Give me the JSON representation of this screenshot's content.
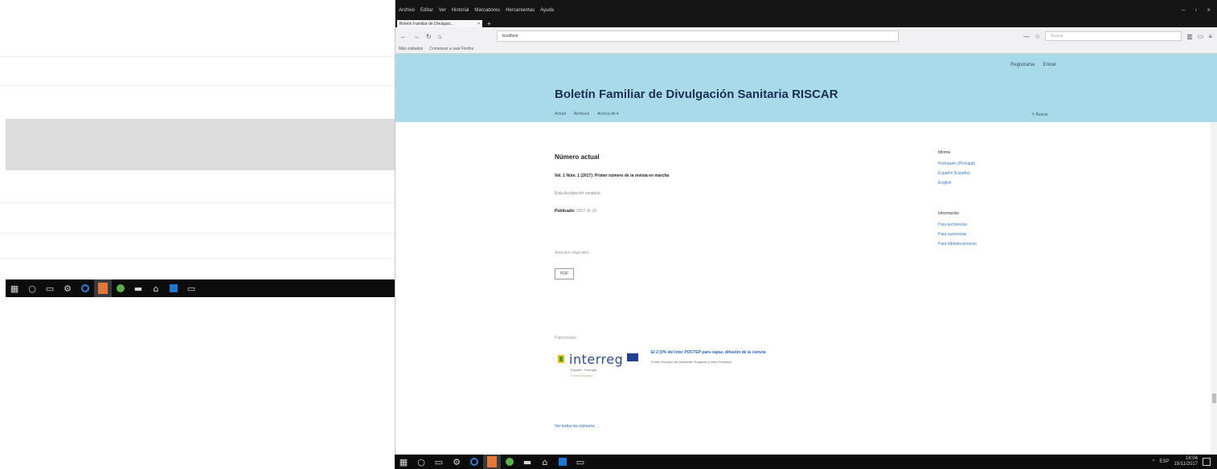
{
  "left_taskbar": {
    "icons": [
      "windows-start-icon",
      "search-icon",
      "task-view-icon",
      "settings-icon",
      "edge-icon",
      "firefox-icon",
      "chrome-icon",
      "folder-icon",
      "store-icon",
      "outlook-icon",
      "terminal-icon"
    ]
  },
  "browser": {
    "menu": [
      "Archivo",
      "Editar",
      "Ver",
      "Historial",
      "Marcadores",
      "Herramientas",
      "Ayuda"
    ],
    "tab_title": "Boletín Familiar de Divulgaci...",
    "url_host": "localhost",
    "bookmarks": [
      "Más visitados",
      "Comenzar a usar Firefox"
    ],
    "search_placeholder": "Buscar",
    "zoom": "—"
  },
  "site": {
    "user_links": [
      "Registrarse",
      "Entrar"
    ],
    "title": "Boletín Familiar de Divulgación Sanitaria RISCAR",
    "nav": [
      "Actual",
      "Archivos",
      "Acerca de ▾"
    ],
    "search_label": "Buscar"
  },
  "main": {
    "section_title": "Número actual",
    "issue_title": "Vol. 1 Núm. 1 (2017): Primer número de la revista en marcha",
    "issue_desc": "Esta divulgación sanitaria",
    "published_label": "Publicado:",
    "published_date": "2017-11-15",
    "articles_heading": "Artículos originales",
    "pdf_label": "PDF",
    "sponsors_heading": "Patrocinado",
    "sponsor_logo_text": "interreg",
    "sponsor_logo_sub": "España - Portugal",
    "sponsor_logo_sub2": "Fondo Europeo",
    "sponsor_link": "El 2 (0% del Inter POCTEP para capaz, difusión de la ciencia",
    "sponsor_note": "Fondo Europeo de Desarrollo Regional (Unión Europea)",
    "more_link": "Ver todos los números →"
  },
  "sidebar": {
    "block1_title": "Idioma",
    "block1_links": [
      "Português (Portugal)",
      "Español (España)",
      "English"
    ],
    "block2_title": "Información",
    "block2_links": [
      "Para lectores/as",
      "Para autores/as",
      "Para bibliotecarios/as"
    ]
  },
  "tray": {
    "time": "18:04",
    "date": "15/11/2017",
    "lang": "ESP"
  }
}
